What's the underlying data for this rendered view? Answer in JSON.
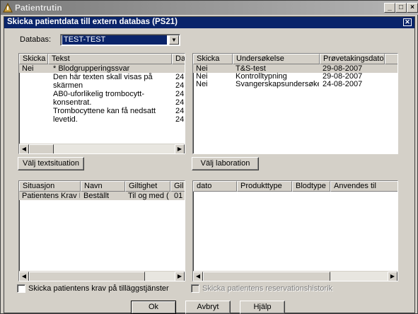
{
  "window": {
    "title": "Patientrutin"
  },
  "dialog": {
    "title": "Skicka patientdata till extern databas (PS21)"
  },
  "database": {
    "label": "Databas:",
    "value": "TEST-TEST"
  },
  "text_table": {
    "headers": [
      "Skicka",
      "Tekst",
      "Da"
    ],
    "rows": [
      {
        "skicka": "Nei",
        "tekst": "* Blodgrupperingssvar",
        "da": ""
      },
      {
        "skicka": "",
        "tekst": "Den här texten skall visas på",
        "da": "24"
      },
      {
        "skicka": "",
        "tekst": "skärmen",
        "da": "24"
      },
      {
        "skicka": "",
        "tekst": "AB0-uforlikelig trombocytt-",
        "da": "24"
      },
      {
        "skicka": "",
        "tekst": "konsentrat.",
        "da": "24"
      },
      {
        "skicka": "",
        "tekst": "Trombocyttene kan få nedsatt",
        "da": "24"
      },
      {
        "skicka": "",
        "tekst": "levetid.",
        "da": "24"
      }
    ]
  },
  "lab_table": {
    "headers": [
      "Skicka",
      "Undersøkelse",
      "Prøvetakingsdato"
    ],
    "rows": [
      {
        "skicka": "Nei",
        "undersokelse": "T&S-test",
        "dato": "29-08-2007"
      },
      {
        "skicka": "Nei",
        "undersokelse": "Kontrolltypning",
        "dato": "29-08-2007"
      },
      {
        "skicka": "Nei",
        "undersokelse": "Svangerskapsundersøkelse",
        "dato": "24-08-2007"
      }
    ]
  },
  "buttons": {
    "valj_textsituation": "Välj textsituation",
    "valj_laboration": "Välj laboration",
    "ok": "Ok",
    "avbryt": "Avbryt",
    "hjalp": "Hjälp"
  },
  "situation_table": {
    "headers": [
      "Situasjon",
      "Navn",
      "Giltighet",
      "Gil"
    ],
    "rows": [
      {
        "situasjon": "Patientens Krav P...",
        "navn": "Beställt",
        "giltighet": "Til og med (...",
        "gil": "01"
      }
    ]
  },
  "blood_table": {
    "headers": [
      "dato",
      "Produkttype",
      "Blodtype",
      "Anvendes til"
    ],
    "rows": []
  },
  "checkboxes": {
    "krav": {
      "label": "Skicka patientens krav på tilläggstjänster",
      "checked": false,
      "enabled": true
    },
    "reservation": {
      "label": "Skicka patientens reservationshistorik",
      "checked": false,
      "enabled": false
    }
  },
  "colors": {
    "title_active": "#0a246a",
    "title_inactive": "#7b7b7b",
    "face": "#d4d0c8"
  }
}
